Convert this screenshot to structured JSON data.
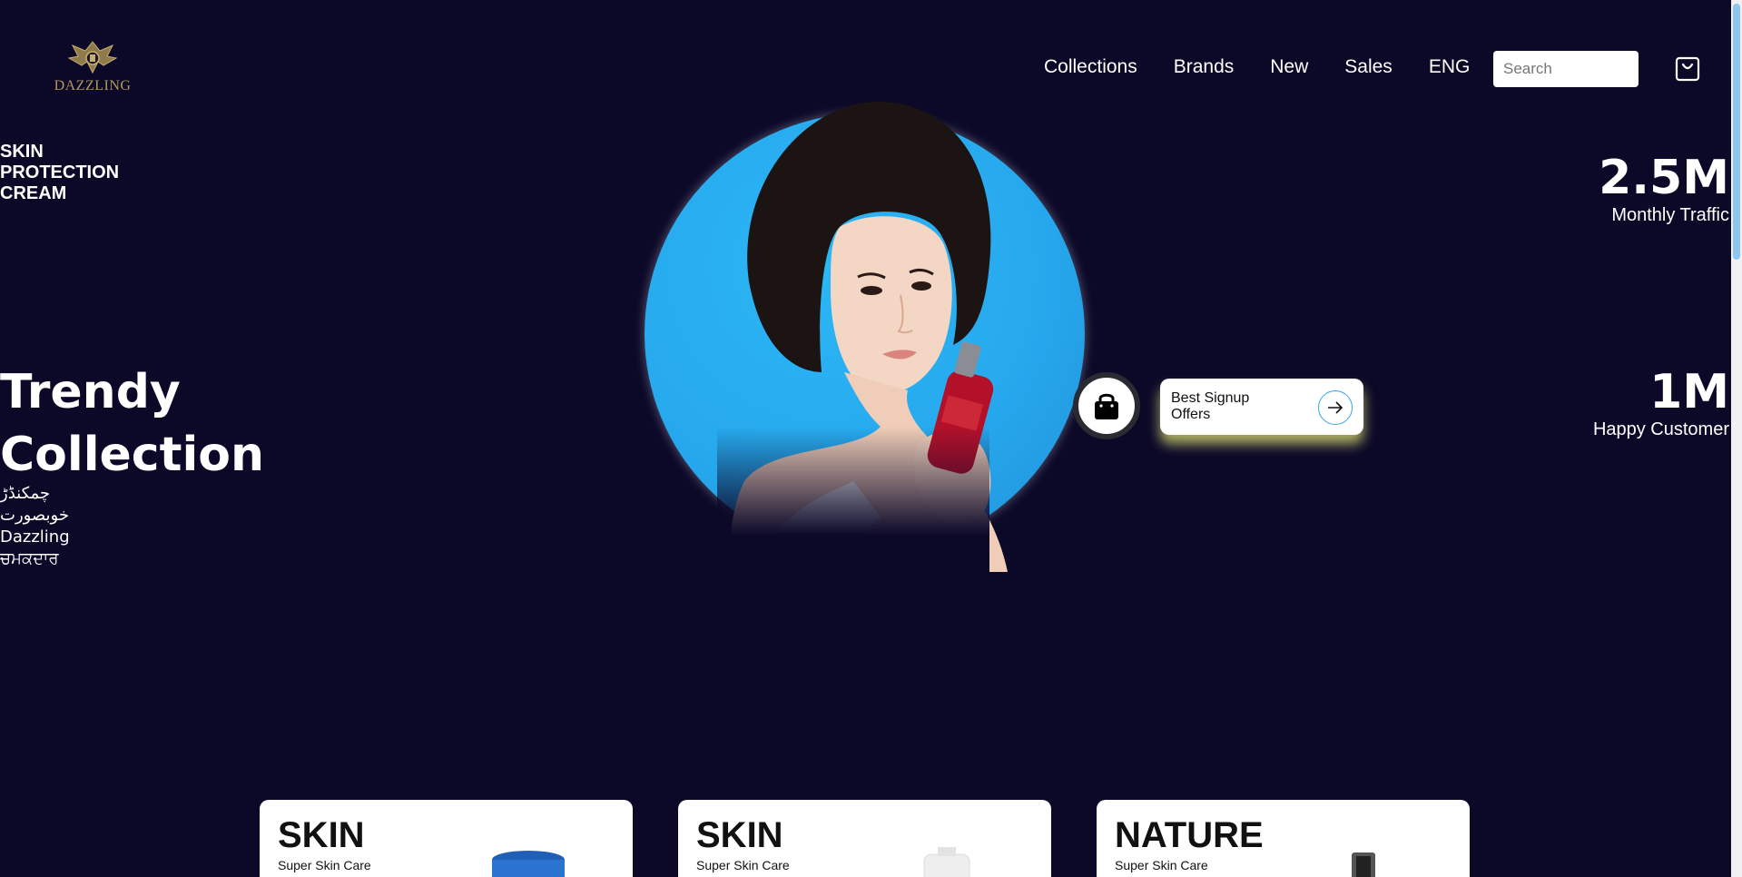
{
  "brand": {
    "name": "DAZZLING"
  },
  "nav": {
    "items": [
      "Collections",
      "Brands",
      "New",
      "Sales",
      "ENG"
    ]
  },
  "search": {
    "placeholder": "Search"
  },
  "hero": {
    "subtitle_lines": [
      "SKIN",
      "PROTECTION",
      "CREAM"
    ],
    "title_lines": [
      "Trendy",
      "Collection"
    ],
    "languages": [
      "چمکنڈڑ",
      "خوبصورت",
      "Dazzling",
      "ਚਮਕਦਾਰ"
    ]
  },
  "stats": [
    {
      "value": "2.5M",
      "label": "Monthly Traffic"
    },
    {
      "value": "1M",
      "label": "Happy Customer"
    }
  ],
  "signup": {
    "label": "Best Signup Offers"
  },
  "cards": [
    {
      "title": "SKIN",
      "subtitle": "Super Skin Care"
    },
    {
      "title": "SKIN",
      "subtitle": "Super Skin Care"
    },
    {
      "title": "NATURE",
      "subtitle": "Super Skin Care"
    }
  ],
  "colors": {
    "background": "#0b0828",
    "hero_circle": "#27a9ee",
    "accent_glow": "#e6e978",
    "arrow_ring": "#3aa3e0"
  },
  "icons": {
    "cart": "shopping-bag-icon",
    "bag": "lock-bag-icon",
    "arrow": "arrow-right-icon"
  }
}
